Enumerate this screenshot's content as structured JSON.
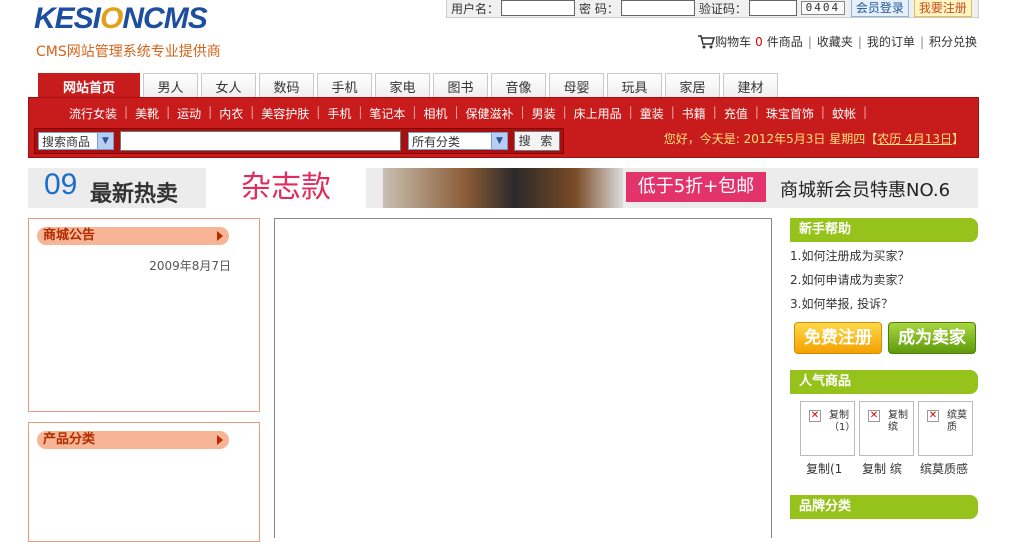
{
  "logo": {
    "text_a": "KESI",
    "text_o": "O",
    "text_b": "NCMS",
    "slogan": "CMS网站管理系统专业提供商"
  },
  "login": {
    "username_label": "用户名：",
    "password_label": "密 码：",
    "captcha_label": "验证码：",
    "captcha_value": "0404",
    "login_button": "会员登录",
    "register_button": "我要注册"
  },
  "quick": {
    "cart_label": "购物车",
    "cart_count": "0",
    "cart_suffix": "件商品",
    "favorites": "收藏夹",
    "orders": "我的订单",
    "points": "积分兑换"
  },
  "tabs": [
    {
      "label": "网站首页"
    },
    {
      "label": "男人"
    },
    {
      "label": "女人"
    },
    {
      "label": "数码"
    },
    {
      "label": "手机"
    },
    {
      "label": "家电"
    },
    {
      "label": "图书"
    },
    {
      "label": "音像"
    },
    {
      "label": "母婴"
    },
    {
      "label": "玩具"
    },
    {
      "label": "家居"
    },
    {
      "label": "建材"
    }
  ],
  "categories": [
    "流行女装",
    "美靴",
    "运动",
    "内衣",
    "美容护肤",
    "手机",
    "笔记本",
    "相机",
    "保健滋补",
    "男装",
    "床上用品",
    "童装",
    "书籍",
    "充值",
    "珠宝首饰",
    "蚊帐"
  ],
  "search": {
    "type_value": "搜索商品",
    "category_value": "所有分类",
    "button": "搜 索"
  },
  "greeting": {
    "text": "您好，今天是: 2012年5月3日 星期四【",
    "lunar": "农历 4月13日",
    "close": "】"
  },
  "banner": {
    "num": "09",
    "hot": "最新热卖",
    "magazine": "杂志款",
    "discount": "低于5折+包邮",
    "member": "商城新会员特惠NO.6"
  },
  "notice": {
    "title": "商城公告",
    "date": "2009年8月7日"
  },
  "product_cat": {
    "title": "产品分类"
  },
  "help": {
    "title": "新手帮助",
    "items": [
      "1.如何注册成为买家？",
      "2.如何申请成为卖家？",
      "3.如何举报, 投诉？"
    ],
    "register": "免费注册",
    "seller": "成为卖家"
  },
  "popular": {
    "title": "人气商品",
    "items": [
      {
        "alt": "复制（1）",
        "name": "复制(1"
      },
      {
        "alt": "复制 缤",
        "name": "复制 缤"
      },
      {
        "alt": "缤莫质",
        "name": "缤莫质感"
      }
    ]
  },
  "brand": {
    "title": "品牌分类"
  },
  "colors": {
    "nav_red": "#c81b1b",
    "accent_green": "#96c21c",
    "link_blue": "#1d4f9e"
  }
}
